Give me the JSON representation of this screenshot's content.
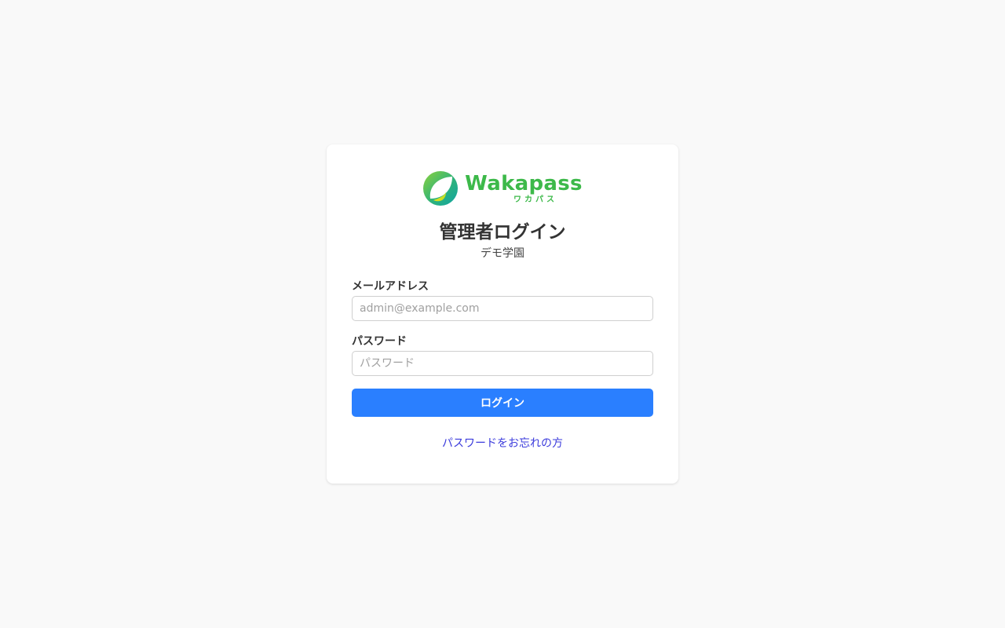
{
  "brand": {
    "name": "Wakapass",
    "kana": "ワカパス",
    "logo_icon": "leaf-logo-icon",
    "colors": {
      "text": "#3db94a",
      "leaf_gradient_start": "#7ac943",
      "leaf_gradient_end": "#12a9a0",
      "leaf_accent": "#d8e21a"
    }
  },
  "page": {
    "title": "管理者ログイン",
    "subtitle": "デモ学園"
  },
  "form": {
    "email": {
      "label": "メールアドレス",
      "placeholder": "admin@example.com",
      "value": ""
    },
    "password": {
      "label": "パスワード",
      "placeholder": "パスワード",
      "value": ""
    },
    "submit_label": "ログイン",
    "forgot_link": "パスワードをお忘れの方"
  },
  "colors": {
    "background": "#f9f9f9",
    "primary_button": "#2a7fff",
    "link": "#3b3bdc"
  }
}
